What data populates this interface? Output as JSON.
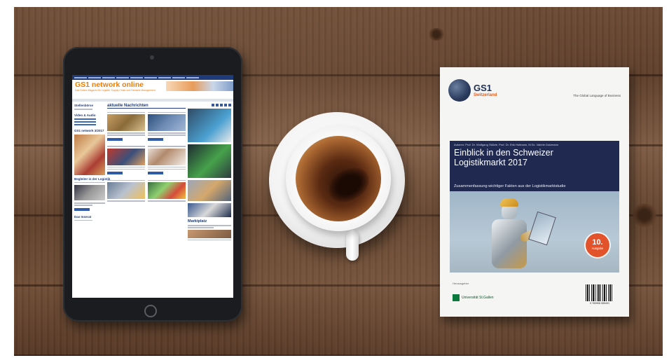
{
  "tablet": {
    "site_title": "GS1 network online",
    "site_tagline": "Das Online-Magazin für Logistik, Supply Chain und Demand Management",
    "news_heading": "aktuelle Nachrichten",
    "left_heading_1": "Stellenbörse",
    "left_heading_2": "Video & Audio",
    "left_heading_3": "GS1 network 3/2017",
    "left_heading_4": "Begleiter in der Logistik",
    "left_heading_5": "Das Inserat",
    "market_heading": "Marktplatz",
    "nav_items": [
      "",
      "",
      "",
      "",
      "",
      "",
      "",
      "",
      ""
    ]
  },
  "brochure": {
    "brand": "GS1",
    "country": "Switzerland",
    "slogan": "The Global Language of Business",
    "authors": "Autoren: Prof. Dr. Wolfgang Stölzle, Prof. Dr. Erik Hofmann, M.Sc. Valerie Dolzmann",
    "title_line1": "Einblick in den Schweizer",
    "title_line2": "Logistikmarkt 2017",
    "subtitle": "Zusammenfassung wichtiger Fakten aus der Logistikmarktstudie",
    "edition_number": "10.",
    "edition_label": "Ausgabe",
    "publisher_label": "Herausgeber",
    "university": "Universität St.Gallen",
    "barcode_number": "9 783906 089401"
  },
  "colors": {
    "gs1_navy": "#202a50",
    "gs1_orange": "#e35c1b",
    "site_orange": "#f07d00",
    "site_blue": "#1f3b7a",
    "wood": "#6b4a34"
  }
}
